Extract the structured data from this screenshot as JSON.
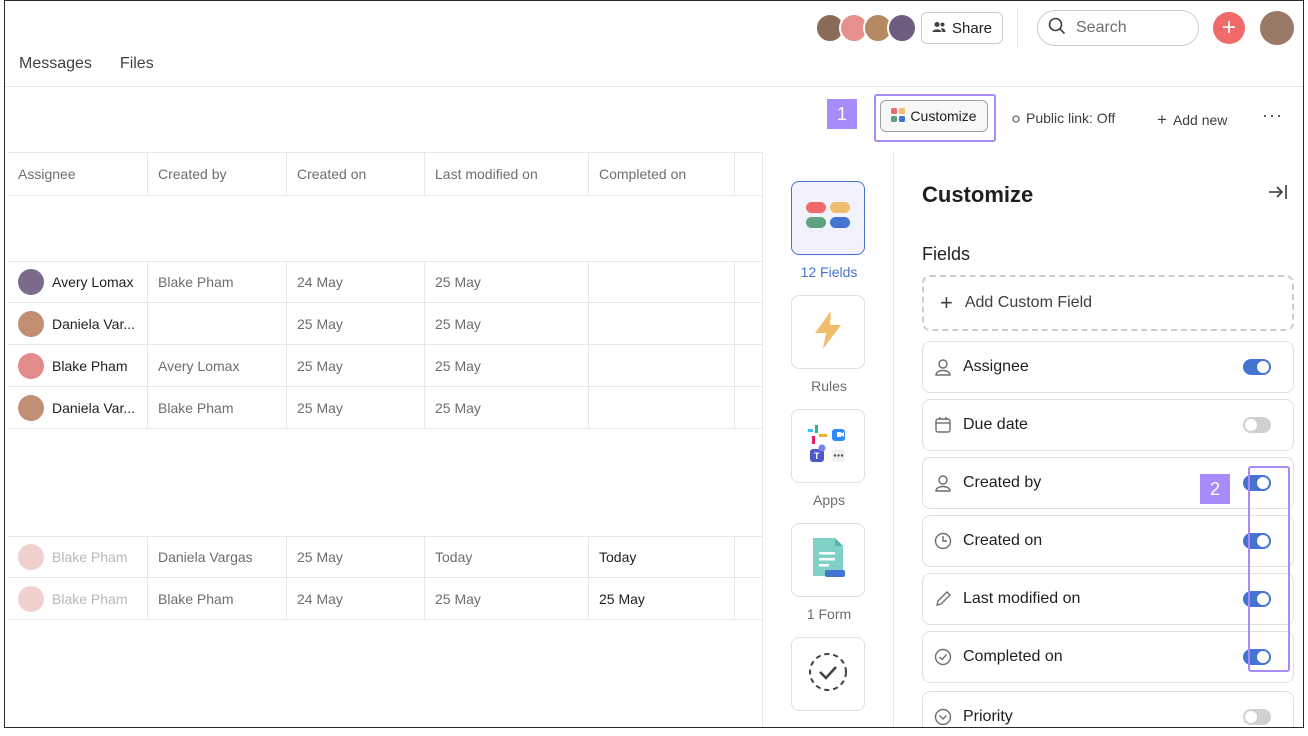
{
  "topbar": {
    "avatars": [
      {
        "name": "user-avatar-1",
        "color": "#8a6b5a"
      },
      {
        "name": "user-avatar-2",
        "color": "#e58f8f"
      },
      {
        "name": "user-avatar-3",
        "color": "#b58963"
      },
      {
        "name": "user-avatar-4",
        "color": "#6d5c7e"
      }
    ],
    "share_label": "Share",
    "search_placeholder": "Search"
  },
  "tabs": [
    "Messages",
    "Files"
  ],
  "toolbar": {
    "marker1": "1",
    "customize_label": "Customize",
    "public_link_label": "Public link: Off",
    "add_new_label": "Add new",
    "more_label": "···"
  },
  "table": {
    "headers": [
      "Assignee",
      "Created by",
      "Created on",
      "Last modified on",
      "Completed on"
    ],
    "rows": [
      {
        "assignee": "Avery Lomax",
        "created_by": "Blake Pham",
        "created_on": "24 May",
        "last_modified": "25 May",
        "completed": "",
        "faded": false,
        "avatar_color": "#7b6a8a"
      },
      {
        "assignee": "Daniela Var...",
        "created_by": "",
        "created_on": "25 May",
        "last_modified": "25 May",
        "completed": "",
        "faded": false,
        "avatar_color": "#c28e74"
      },
      {
        "assignee": "Blake Pham",
        "created_by": "Avery Lomax",
        "created_on": "25 May",
        "last_modified": "25 May",
        "completed": "",
        "faded": false,
        "avatar_color": "#e38b8b"
      },
      {
        "assignee": "Daniela Var...",
        "created_by": "Blake Pham",
        "created_on": "25 May",
        "last_modified": "25 May",
        "completed": "",
        "faded": false,
        "avatar_color": "#c28e74"
      },
      {
        "assignee": "Blake Pham",
        "created_by": "Daniela Vargas",
        "created_on": "25 May",
        "last_modified": "Today",
        "completed": "Today",
        "faded": true,
        "avatar_color": "#f1d0d0"
      },
      {
        "assignee": "Blake Pham",
        "created_by": "Blake Pham",
        "created_on": "24 May",
        "last_modified": "25 May",
        "completed": "25 May",
        "faded": true,
        "avatar_color": "#f1d0d0"
      }
    ]
  },
  "rail": {
    "fields_label": "12 Fields",
    "rules_label": "Rules",
    "apps_label": "Apps",
    "form_label": "1 Form"
  },
  "panel": {
    "title": "Customize",
    "fields_heading": "Fields",
    "add_custom_field": "Add Custom Field",
    "marker2": "2",
    "fields": [
      {
        "label": "Assignee",
        "icon": "person-icon",
        "on": true
      },
      {
        "label": "Due date",
        "icon": "calendar-icon",
        "on": false
      },
      {
        "label": "Created by",
        "icon": "person-icon",
        "on": true
      },
      {
        "label": "Created on",
        "icon": "clock-icon",
        "on": true
      },
      {
        "label": "Last modified on",
        "icon": "pencil-icon",
        "on": true
      },
      {
        "label": "Completed on",
        "icon": "check-circle-icon",
        "on": true
      },
      {
        "label": "Priority",
        "icon": "chevron-circle-icon",
        "on": false
      }
    ]
  },
  "colors": {
    "accent_blue": "#4573d2",
    "marker_purple": "#a78bfa",
    "add_red": "#f06a6a"
  }
}
